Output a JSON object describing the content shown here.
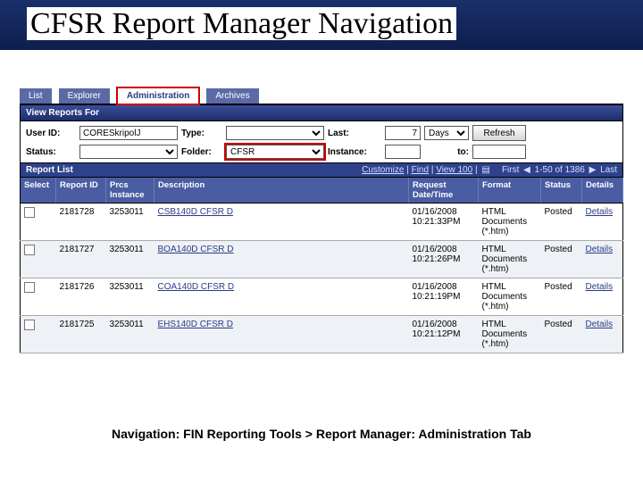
{
  "title": "CFSR Report Manager Navigation",
  "tabs": {
    "list": "List",
    "explorer": "Explorer",
    "administration": "Administration",
    "archives": "Archives"
  },
  "section_view_reports_for": "View Reports For",
  "filters": {
    "user_id_label": "User ID:",
    "user_id_value": "CORESkripolJ",
    "type_label": "Type:",
    "type_value": "",
    "last_label": "Last:",
    "last_value": "7",
    "last_unit": "Days",
    "refresh_label": "Refresh",
    "status_label": "Status:",
    "status_value": "",
    "folder_label": "Folder:",
    "folder_value": "CFSR",
    "instance_label": "Instance:",
    "instance_value": "",
    "to_label": "to:",
    "to_value": ""
  },
  "list": {
    "heading": "Report List",
    "customize": "Customize",
    "find": "Find",
    "view100": "View 100",
    "range": "1-50 of 1386",
    "first": "First",
    "last": "Last"
  },
  "columns": {
    "select": "Select",
    "report_id": "Report ID",
    "prcs_instance": "Prcs Instance",
    "description": "Description",
    "request_dt": "Request Date/Time",
    "format": "Format",
    "status": "Status",
    "details": "Details"
  },
  "rows": [
    {
      "report_id": "2181728",
      "prcs": "3253011",
      "desc": "CSB140D CFSR D",
      "dt": "01/16/2008 10:21:33PM",
      "fmt": "HTML Documents (*.htm)",
      "status": "Posted",
      "details": "Details"
    },
    {
      "report_id": "2181727",
      "prcs": "3253011",
      "desc": "BOA140D CFSR D",
      "dt": "01/16/2008 10:21:26PM",
      "fmt": "HTML Documents (*.htm)",
      "status": "Posted",
      "details": "Details"
    },
    {
      "report_id": "2181726",
      "prcs": "3253011",
      "desc": "COA140D CFSR D",
      "dt": "01/16/2008 10:21:19PM",
      "fmt": "HTML Documents (*.htm)",
      "status": "Posted",
      "details": "Details"
    },
    {
      "report_id": "2181725",
      "prcs": "3253011",
      "desc": "EHS140D CFSR D",
      "dt": "01/16/2008 10:21:12PM",
      "fmt": "HTML Documents (*.htm)",
      "status": "Posted",
      "details": "Details"
    }
  ],
  "footer": "Navigation:  FIN Reporting Tools > Report Manager:  Administration Tab"
}
